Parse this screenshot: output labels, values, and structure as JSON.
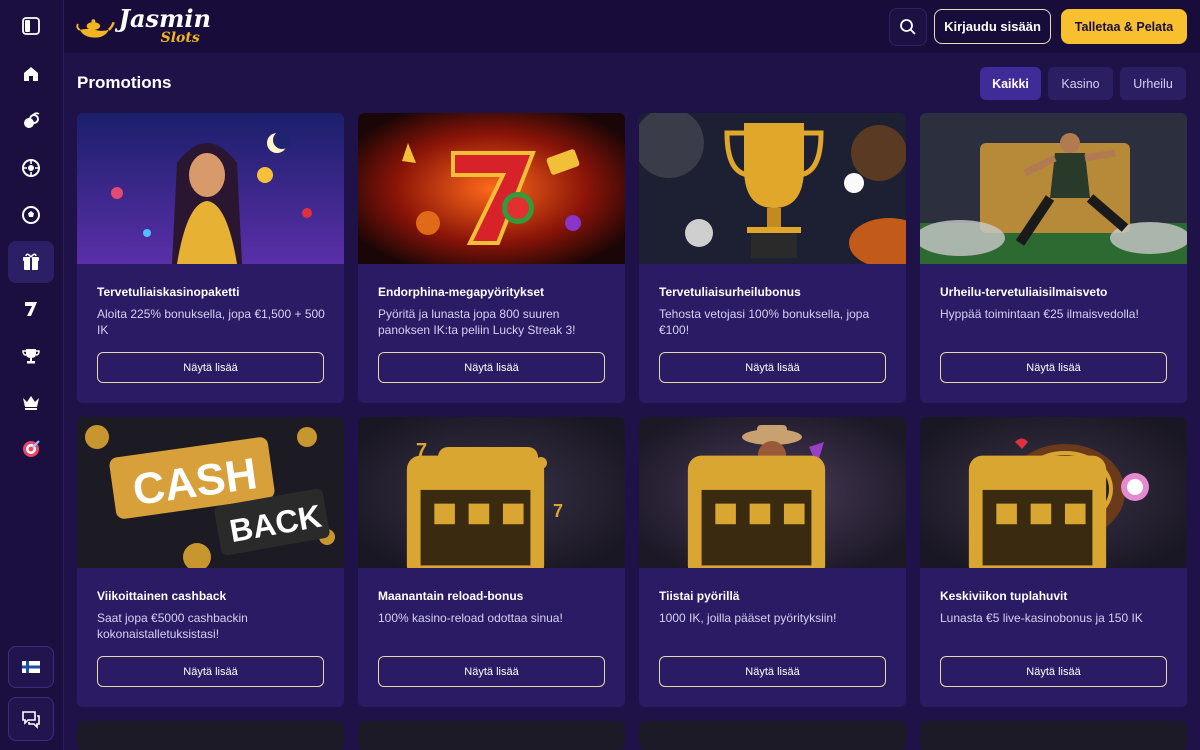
{
  "header": {
    "logo_main": "Jasmin",
    "logo_sub": "Slots",
    "login_label": "Kirjaudu sisään",
    "deposit_label": "Talletaa & Pelata"
  },
  "sidebar": {
    "items": [
      {
        "icon": "panel-toggle-icon"
      },
      {
        "icon": "home-icon"
      },
      {
        "icon": "cherry-icon"
      },
      {
        "icon": "roulette-icon"
      },
      {
        "icon": "soccer-ball-icon"
      },
      {
        "icon": "gift-icon",
        "active": true
      },
      {
        "icon": "seven-icon"
      },
      {
        "icon": "trophy-icon"
      },
      {
        "icon": "crown-icon"
      },
      {
        "icon": "target-icon"
      }
    ],
    "bottom": [
      {
        "icon": "finland-flag-icon"
      },
      {
        "icon": "chat-icon"
      }
    ]
  },
  "page": {
    "title": "Promotions",
    "filters": [
      {
        "label": "Kaikki",
        "active": true
      },
      {
        "label": "Kasino",
        "active": false
      },
      {
        "label": "Urheilu",
        "active": false
      }
    ]
  },
  "cards": [
    {
      "title": "Tervetuliaiskasinopaketti",
      "desc": "Aloita 225% bonuksella, jopa €1,500 + 500 IK",
      "button": "Näytä lisää",
      "image": "genie-girl-image"
    },
    {
      "title": "Endorphina-megapyöritykset",
      "desc": "Pyöritä ja lunasta jopa 800 suuren panoksen IK:ta peliin Lucky Streak 3!",
      "button": "Näytä lisää",
      "image": "lucky-seven-image"
    },
    {
      "title": "Tervetuliaisurheilubonus",
      "desc": "Tehosta vetojasi 100% bonuksella, jopa €100!",
      "button": "Näytä lisää",
      "image": "trophy-image"
    },
    {
      "title": "Urheilu-tervetuliaisilmaisveto",
      "desc": "Hyppää toimintaan €25 ilmaisvedolla!",
      "button": "Näytä lisää",
      "image": "football-player-image"
    },
    {
      "title": "Viikoittainen cashback",
      "desc": "Saat jopa €5000 cashbackin kokonaistalletuksistasi!",
      "button": "Näytä lisää",
      "image": "cashback-image"
    },
    {
      "title": "Maanantain reload-bonus",
      "desc": "100% kasino-reload odottaa sinua!",
      "button": "Näytä lisää",
      "image": "slot-machine-image"
    },
    {
      "title": "Tiistai pyörillä",
      "desc": "1000 IK, joilla pääset pyörityksiin!",
      "button": "Näytä lisää",
      "image": "cowboy-image"
    },
    {
      "title": "Keskiviikon tuplahuvit",
      "desc": "Lunasta €5 live-kasinobonus ja 150 IK",
      "button": "Näytä lisää",
      "image": "roulette-wheel-image"
    }
  ],
  "colors": {
    "background": "#1e1248",
    "card": "#2a1b64",
    "accent": "#f8c02e"
  }
}
